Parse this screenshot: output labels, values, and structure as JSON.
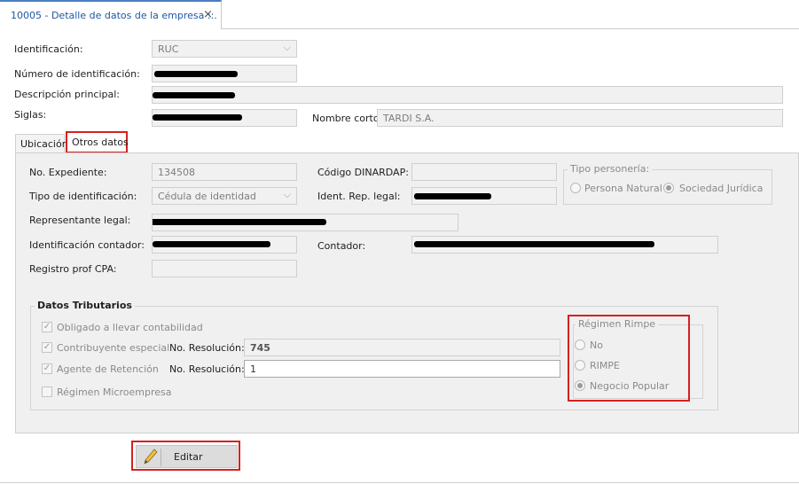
{
  "doc_tab": {
    "title": "10005 - Detalle de datos de la empresa  ::.",
    "close": "×"
  },
  "header": {
    "identificacion_label": "Identificación:",
    "identificacion_value": "RUC",
    "numero_label": "Número de identificación:",
    "descripcion_label": "Descripción principal:",
    "siglas_label": "Siglas:",
    "nombre_corto_label": "Nombre corto:",
    "nombre_corto_value": "TARDI S.A."
  },
  "tabs": {
    "ubicacion": "Ubicación",
    "otros": "Otros datos"
  },
  "otros": {
    "expediente_label": "No. Expediente:",
    "expediente_value": "134508",
    "dinardap_label": "Código DINARDAP:",
    "tipo_id_label": "Tipo de identificación:",
    "tipo_id_value": "Cédula de identidad",
    "ident_rep_label": "Ident. Rep. legal:",
    "representante_label": "Representante legal:",
    "id_contador_label": "Identificación contador:",
    "contador_label": "Contador:",
    "registro_cpa_label": "Registro prof CPA:",
    "tipo_personeria": {
      "title": "Tipo personería:",
      "options": [
        "Persona Natural",
        "Sociedad Jurídica"
      ],
      "selected": "Sociedad Jurídica"
    }
  },
  "tributarios": {
    "title": "Datos Tributarios",
    "obligado": "Obligado a llevar contabilidad",
    "contribuyente": "Contribuyente especial",
    "agente": "Agente de Retención",
    "microempresa": "Régimen Microempresa",
    "resolucion_label": "No. Resolución:",
    "resolucion_1": "745",
    "resolucion_2": "1",
    "checked": {
      "obligado": true,
      "contribuyente": true,
      "agente": true,
      "microempresa": false
    }
  },
  "rimpe": {
    "title": "Régimen Rimpe",
    "options": [
      "No",
      "RIMPE",
      "Negocio Popular"
    ],
    "selected": "Negocio Popular"
  },
  "actions": {
    "editar": "Editar"
  },
  "colors": {
    "highlight": "#d62020",
    "tab_title": "#1f57a4",
    "panel": "#f0f0f0"
  }
}
